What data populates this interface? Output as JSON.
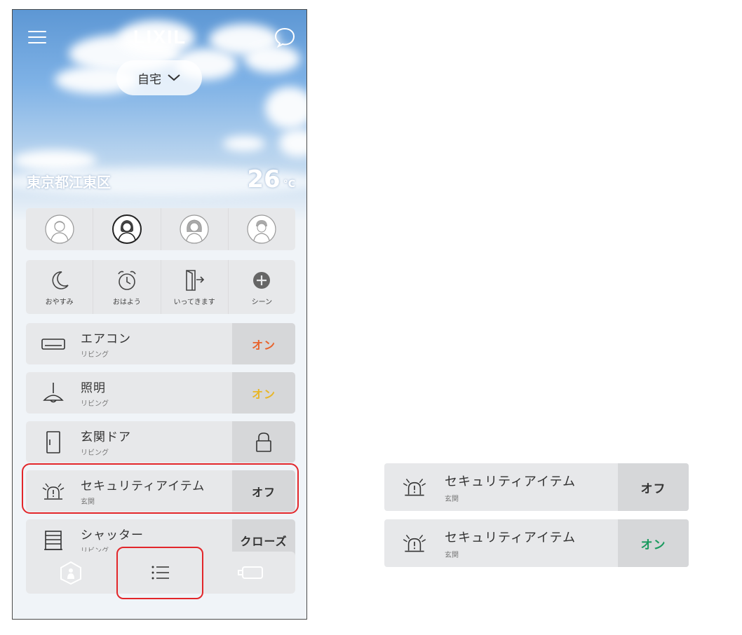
{
  "header": {
    "logo": "LIXIL",
    "location": "自宅",
    "city": "東京都江東区",
    "temperature": "26",
    "temperature_unit": "°C"
  },
  "members": [
    "member-1",
    "member-2",
    "member-3",
    "member-4"
  ],
  "scenes": [
    {
      "label": "おやすみ",
      "icon": "moon-icon"
    },
    {
      "label": "おはよう",
      "icon": "alarm-clock-icon"
    },
    {
      "label": "いってきます",
      "icon": "door-exit-icon"
    },
    {
      "label": "シーン",
      "icon": "plus-circle-icon"
    }
  ],
  "devices": [
    {
      "name": "エアコン",
      "room": "リビング",
      "action": "オン",
      "action_color": "#e8632c",
      "icon": "air-conditioner-icon"
    },
    {
      "name": "照明",
      "room": "リビング",
      "action": "オン",
      "action_color": "#e8b628",
      "icon": "ceiling-light-icon"
    },
    {
      "name": "玄関ドア",
      "room": "リビング",
      "action": "",
      "icon": "door-icon",
      "action_icon": "lock-icon"
    },
    {
      "name": "セキュリティアイテム",
      "room": "玄関",
      "action": "オフ",
      "action_color": "#333333",
      "icon": "alarm-siren-icon"
    },
    {
      "name": "シャッター",
      "room": "リビング",
      "action": "クローズ",
      "action_color": "#333333",
      "icon": "shutter-icon"
    }
  ],
  "bottom_nav": [
    {
      "icon": "home-person-icon"
    },
    {
      "icon": "list-icon"
    },
    {
      "icon": "device-icon"
    }
  ],
  "detail_cards": [
    {
      "name": "セキュリティアイテム",
      "room": "玄関",
      "action": "オフ",
      "action_color": "#333333"
    },
    {
      "name": "セキュリティアイテム",
      "room": "玄関",
      "action": "オン",
      "action_color": "#1a9a5e"
    }
  ],
  "colors": {
    "highlight": "#e2262a",
    "card": "#e7e8ea",
    "action_bg": "#d6d7d9"
  }
}
